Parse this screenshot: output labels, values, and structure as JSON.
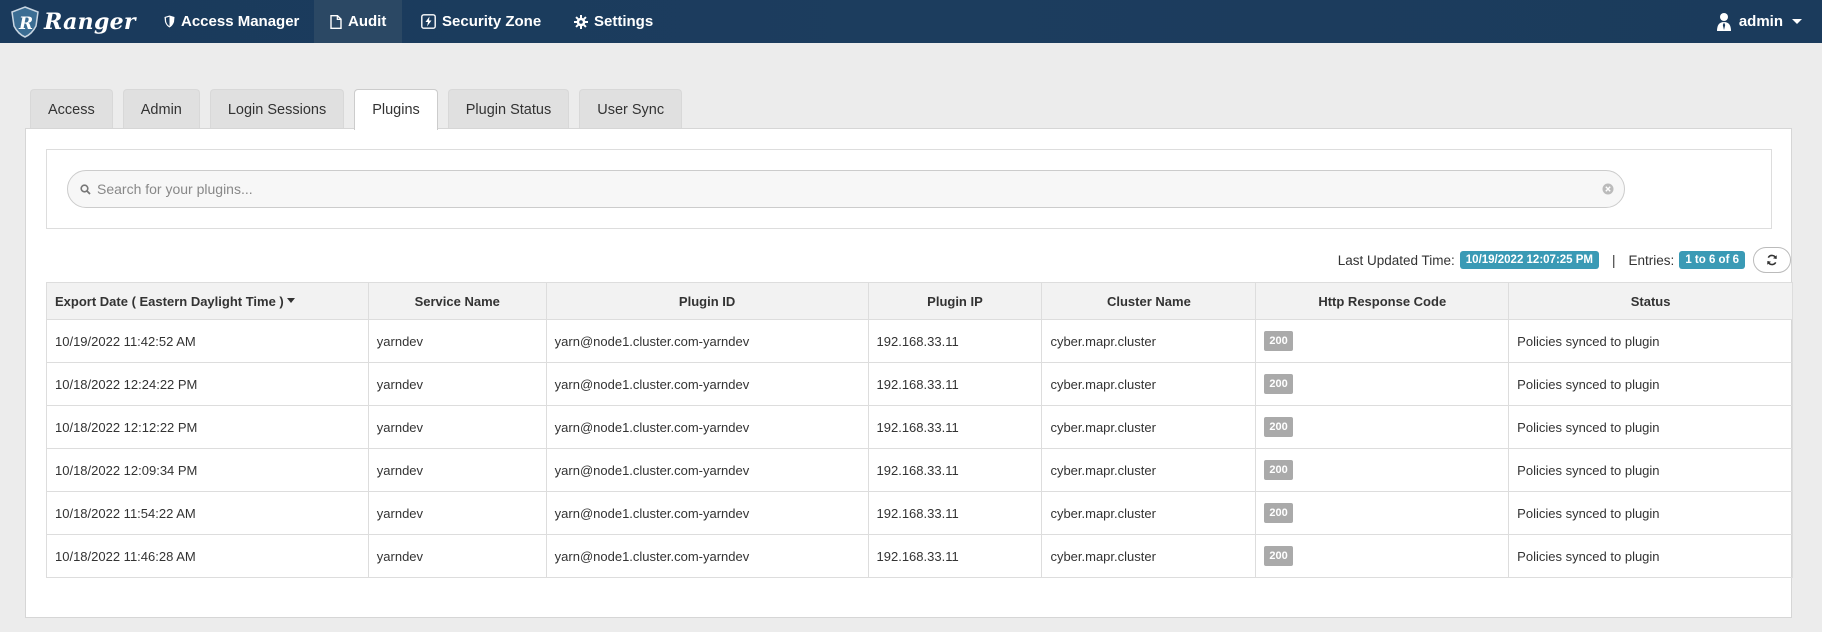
{
  "brand": {
    "name": "Ranger"
  },
  "nav": {
    "items": [
      {
        "label": "Access Manager",
        "icon": "shield-icon"
      },
      {
        "label": "Audit",
        "icon": "file-icon"
      },
      {
        "label": "Security Zone",
        "icon": "bolt-icon"
      },
      {
        "label": "Settings",
        "icon": "gear-icon"
      }
    ],
    "active": "Audit",
    "user": "admin"
  },
  "tabs": [
    "Access",
    "Admin",
    "Login Sessions",
    "Plugins",
    "Plugin Status",
    "User Sync"
  ],
  "active_tab": "Plugins",
  "search": {
    "placeholder": "Search for your plugins..."
  },
  "meta": {
    "last_updated_label": "Last Updated Time:",
    "last_updated_value": "10/19/2022 12:07:25 PM",
    "separator": "|",
    "entries_label": "Entries:",
    "entries_value": "1 to 6 of 6"
  },
  "table": {
    "headers": [
      "Export Date ( Eastern Daylight Time )",
      "Service Name",
      "Plugin ID",
      "Plugin IP",
      "Cluster Name",
      "Http Response Code",
      "Status"
    ],
    "rows": [
      [
        "10/19/2022 11:42:52 AM",
        "yarndev",
        "yarn@node1.cluster.com-yarndev",
        "192.168.33.11",
        "cyber.mapr.cluster",
        "200",
        "Policies synced to plugin"
      ],
      [
        "10/18/2022 12:24:22 PM",
        "yarndev",
        "yarn@node1.cluster.com-yarndev",
        "192.168.33.11",
        "cyber.mapr.cluster",
        "200",
        "Policies synced to plugin"
      ],
      [
        "10/18/2022 12:12:22 PM",
        "yarndev",
        "yarn@node1.cluster.com-yarndev",
        "192.168.33.11",
        "cyber.mapr.cluster",
        "200",
        "Policies synced to plugin"
      ],
      [
        "10/18/2022 12:09:34 PM",
        "yarndev",
        "yarn@node1.cluster.com-yarndev",
        "192.168.33.11",
        "cyber.mapr.cluster",
        "200",
        "Policies synced to plugin"
      ],
      [
        "10/18/2022 11:54:22 AM",
        "yarndev",
        "yarn@node1.cluster.com-yarndev",
        "192.168.33.11",
        "cyber.mapr.cluster",
        "200",
        "Policies synced to plugin"
      ],
      [
        "10/18/2022 11:46:28 AM",
        "yarndev",
        "yarn@node1.cluster.com-yarndev",
        "192.168.33.11",
        "cyber.mapr.cluster",
        "200",
        "Policies synced to plugin"
      ]
    ]
  },
  "colors": {
    "navbar": "#1a3a5c",
    "badge": "#3a9ab5",
    "code_badge": "#aaaaaa"
  }
}
